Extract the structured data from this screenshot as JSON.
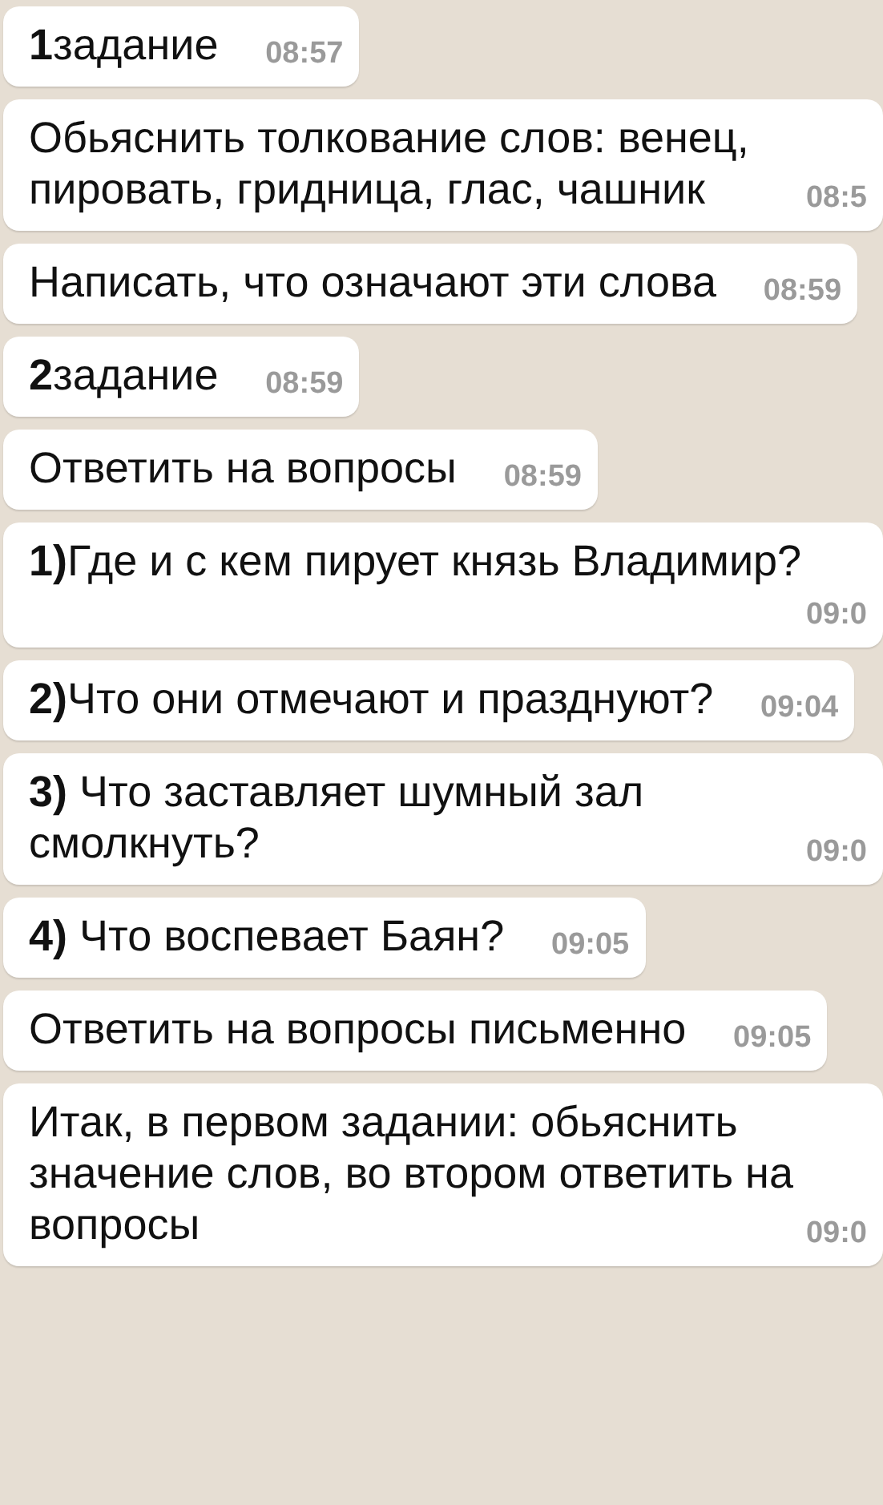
{
  "messages": [
    {
      "text": "**1**задание",
      "time": "08:57"
    },
    {
      "text": "Обьяснить толкование слов: венец, пировать, гридница, глас, чашник",
      "time": "08:5"
    },
    {
      "text": "Написать, что означают эти слова",
      "time": "08:59"
    },
    {
      "text": "**2**задание",
      "time": "08:59"
    },
    {
      "text": "Ответить на вопросы",
      "time": "08:59"
    },
    {
      "text": "**1)**Где и с кем пирует князь Владимир?",
      "time": "09:0"
    },
    {
      "text": "**2)**Что они отмечают и празднуют?",
      "time": "09:04"
    },
    {
      "text": "**3)** Что заставляет шумный зал смолкнуть?",
      "time": "09:0"
    },
    {
      "text": "**4)** Что воспевает Баян?",
      "time": "09:05"
    },
    {
      "text": "Ответить на вопросы письменно",
      "time": "09:05"
    },
    {
      "text": "Итак, в первом задании: обьяснить значение слов, во втором ответить на вопросы",
      "time": "09:0"
    }
  ]
}
